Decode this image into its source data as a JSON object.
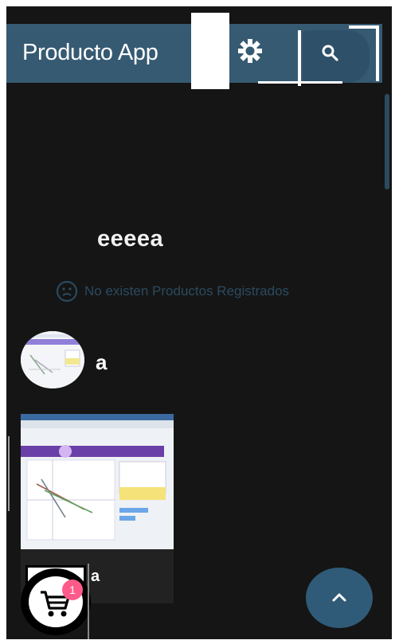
{
  "app": {
    "title": "Producto App"
  },
  "toolbar": {
    "settings_icon": "gear-icon",
    "search_icon": "search-icon"
  },
  "main": {
    "heading": "eeeea",
    "empty_state": {
      "icon": "sad-face-icon",
      "text": "No existen Productos Registrados"
    }
  },
  "products": [
    {
      "name": "a"
    },
    {
      "name": "a"
    }
  ],
  "cart": {
    "count": "1",
    "icon": "cart-icon"
  },
  "fab": {
    "icon": "chevron-up-icon"
  },
  "colors": {
    "primary": "#365a72",
    "background": "#151515",
    "empty_text": "#2b4a5f",
    "badge": "#ff5b8a",
    "fab": "#2f5b78"
  }
}
